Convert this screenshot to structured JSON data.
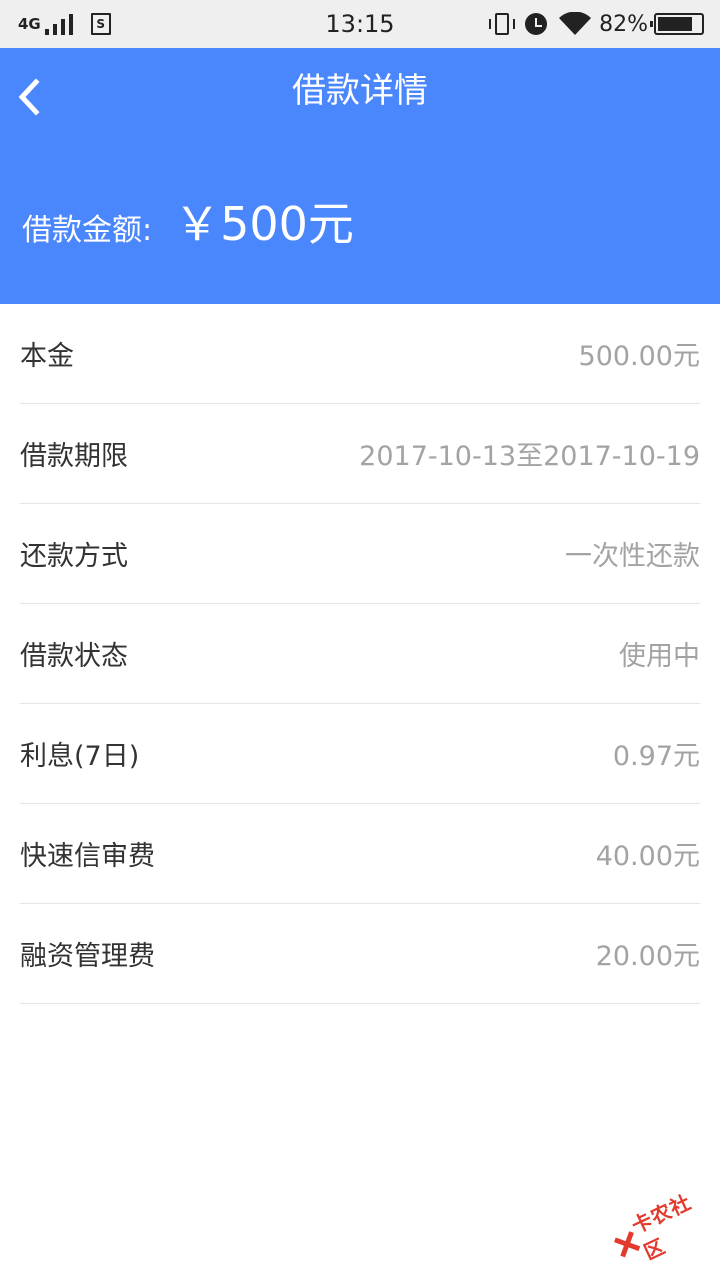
{
  "status_bar": {
    "network": "4G",
    "time": "13:15",
    "battery": "82%",
    "battery_level": 0.82,
    "sim_label": "S",
    "icons": [
      "signal-icon",
      "sim-icon",
      "vibrate-icon",
      "alarm-icon",
      "wifi-icon",
      "battery-icon"
    ]
  },
  "header": {
    "title": "借款详情",
    "back_icon": "chevron-left-icon",
    "amount_label": "借款金额:",
    "amount_value": "￥500元",
    "background_color": "#4a86fc"
  },
  "details": {
    "rows": [
      {
        "label": "本金",
        "value": "500.00元"
      },
      {
        "label": "借款期限",
        "value": "2017-10-13至2017-10-19"
      },
      {
        "label": "还款方式",
        "value": "一次性还款"
      },
      {
        "label": "借款状态",
        "value": "使用中"
      },
      {
        "label": "利息(7日)",
        "value": "0.97元"
      },
      {
        "label": "快速信审费",
        "value": "40.00元"
      },
      {
        "label": "融资管理费",
        "value": "20.00元"
      }
    ]
  },
  "watermark": {
    "text": "卡农社区",
    "color": "#e23b2e"
  }
}
